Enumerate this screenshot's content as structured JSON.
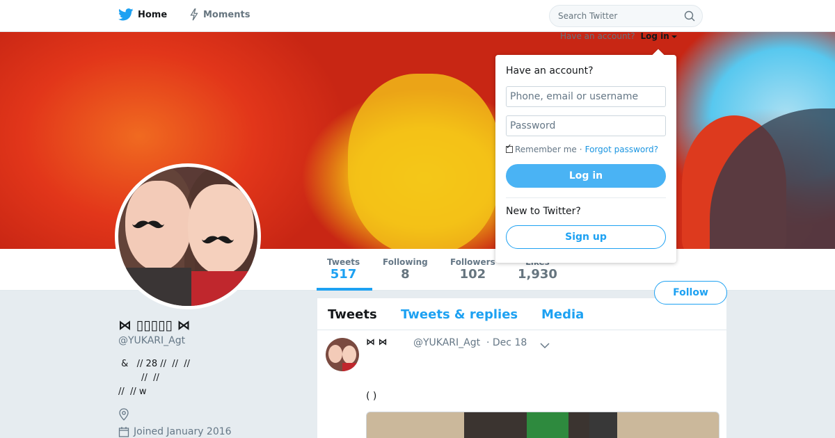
{
  "nav": {
    "home_label": "Home",
    "moments_label": "Moments",
    "search_placeholder": "Search Twitter"
  },
  "account_prompt": {
    "text": "Have an account?",
    "login_label": "Log in"
  },
  "login_dropdown": {
    "heading": "Have an account?",
    "username_placeholder": "Phone, email or username",
    "password_placeholder": "Password",
    "remember_label": "Remember me",
    "separator": "·",
    "forgot_label": "Forgot password?",
    "login_button": "Log in",
    "new_prompt": "New to Twitter?",
    "signup_button": "Sign up"
  },
  "stats": [
    {
      "label": "Tweets",
      "value": "517"
    },
    {
      "label": "Following",
      "value": "8"
    },
    {
      "label": "Followers",
      "value": "102"
    },
    {
      "label": "Likes",
      "value": "1,930"
    }
  ],
  "follow_button": "Follow",
  "profile": {
    "name": "⋈ ▯▯▯▯▯ ⋈",
    "handle": "@YUKARI_Agt",
    "bio": " &   // 28 //  //  //\n        //  //\n//  // w",
    "joined": "Joined January 2016"
  },
  "timeline": {
    "tabs": [
      "Tweets",
      "Tweets & replies",
      "Media"
    ],
    "tweet": {
      "name": "⋈  ⋈",
      "handle": "@YUKARI_Agt",
      "date": "· Dec 18",
      "text": "(  )"
    }
  },
  "colors": {
    "accent": "#1da1f2",
    "login_button": "#4ab3f4",
    "page_bg": "#e6ecf0"
  }
}
